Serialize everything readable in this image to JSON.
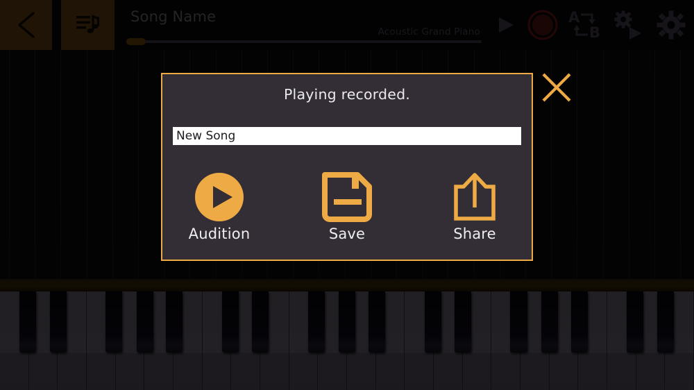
{
  "app": {
    "background": "#0a080a",
    "accent": "#eeaa44",
    "toolbar_button_bg": "#422a0d"
  },
  "topbar": {
    "back_button": {
      "label": "",
      "icon": "chevron-left-icon"
    },
    "songs_button": {
      "label": "",
      "icon": "song-list-icon"
    },
    "song_title": "Song Name",
    "instrument": "Acoustic Grand Piano",
    "progress": {
      "value_percent": 0
    },
    "controls": [
      {
        "name": "play",
        "icon": "play-icon"
      },
      {
        "name": "record",
        "icon": "record-icon",
        "color": "#3a0d0d"
      },
      {
        "name": "ab-loop",
        "icon": "ab-loop-icon",
        "label_a": "A",
        "label_b": "B"
      },
      {
        "name": "autoplay-settings",
        "icon": "gear-play-icon"
      },
      {
        "name": "settings",
        "icon": "gear-icon"
      }
    ]
  },
  "dialog": {
    "title": "Playing recorded.",
    "song_name_value": "New Song",
    "song_name_placeholder": "New Song",
    "border_color": "#eeaa44",
    "background": "#332e36",
    "actions": [
      {
        "label": "Audition",
        "icon": "play-circle-icon"
      },
      {
        "label": "Save",
        "icon": "floppy-disk-icon"
      },
      {
        "label": "Share",
        "icon": "share-upload-icon"
      }
    ],
    "close": {
      "icon": "close-x-icon",
      "color": "#eeaa44"
    }
  },
  "keyboard": {
    "white_key_count": 24,
    "octave_pattern_black_offsets": [
      0.68,
      1.72,
      3.65,
      4.72,
      5.74
    ]
  }
}
